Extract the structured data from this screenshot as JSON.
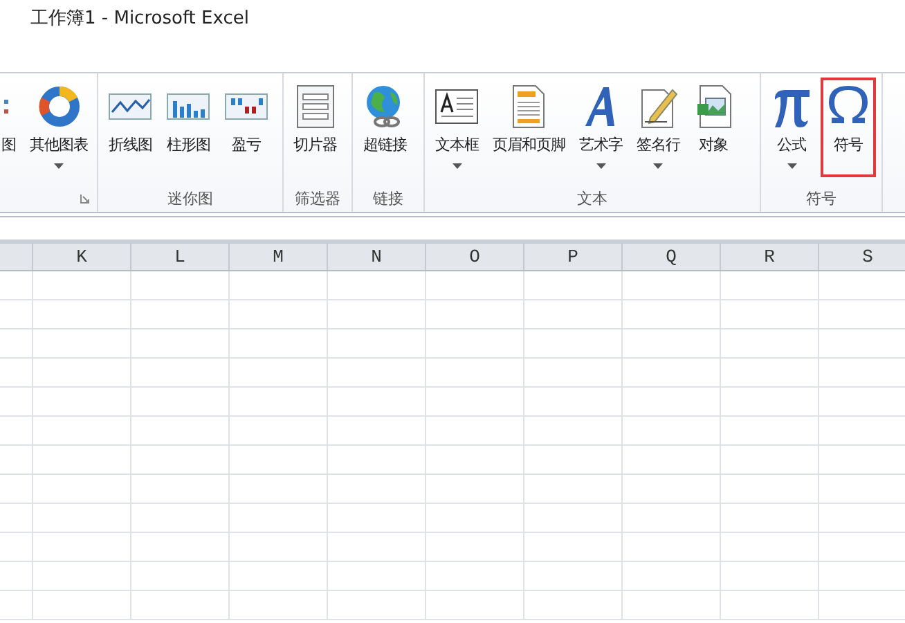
{
  "window": {
    "title": "工作簿1 - Microsoft Excel"
  },
  "ribbon": {
    "groups": [
      {
        "launcher": true,
        "buttons": [
          {
            "label": "图",
            "kind": "partial",
            "dropdown": false,
            "highlighted": false
          },
          {
            "label": "其他图表",
            "kind": "donut",
            "dropdown": true,
            "highlighted": false
          }
        ]
      },
      {
        "label": "迷你图",
        "launcher": false,
        "buttons": [
          {
            "label": "折线图",
            "kind": "line",
            "dropdown": false,
            "highlighted": false
          },
          {
            "label": "柱形图",
            "kind": "column",
            "dropdown": false,
            "highlighted": false
          },
          {
            "label": "盈亏",
            "kind": "winloss",
            "dropdown": false,
            "highlighted": false
          }
        ]
      },
      {
        "label": "筛选器",
        "launcher": false,
        "buttons": [
          {
            "label": "切片器",
            "kind": "slicer",
            "dropdown": false,
            "highlighted": false
          }
        ]
      },
      {
        "label": "链接",
        "launcher": false,
        "buttons": [
          {
            "label": "超链接",
            "kind": "globe",
            "dropdown": false,
            "highlighted": false
          }
        ]
      },
      {
        "label": "文本",
        "launcher": false,
        "buttons": [
          {
            "label": "文本框",
            "kind": "textbox",
            "dropdown": true,
            "highlighted": false
          },
          {
            "label": "页眉和页脚",
            "kind": "header",
            "dropdown": false,
            "highlighted": false
          },
          {
            "label": "艺术字",
            "kind": "wordart",
            "dropdown": true,
            "highlighted": false
          },
          {
            "label": "签名行",
            "kind": "signature",
            "dropdown": true,
            "highlighted": false
          },
          {
            "label": "对象",
            "kind": "object",
            "dropdown": false,
            "highlighted": false
          }
        ]
      },
      {
        "label": "符号",
        "launcher": false,
        "buttons": [
          {
            "label": "公式",
            "kind": "pi",
            "dropdown": true,
            "highlighted": false
          },
          {
            "label": "符号",
            "kind": "omega",
            "dropdown": false,
            "highlighted": true
          }
        ]
      }
    ]
  },
  "sheet": {
    "columns": [
      "K",
      "L",
      "M",
      "N",
      "O",
      "P",
      "Q",
      "R",
      "S"
    ]
  }
}
